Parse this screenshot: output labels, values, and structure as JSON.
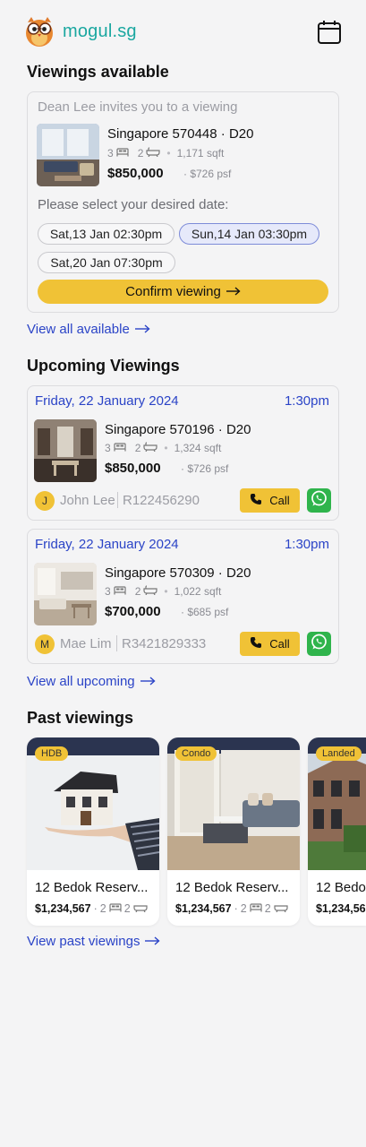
{
  "app": {
    "brand": "mogul.sg",
    "brand_color": "#1aa7a0",
    "accent_color": "#f0c236",
    "link_color": "#2b44c7"
  },
  "available": {
    "title": "Viewings available",
    "invite_text": "Dean Lee invites you to a viewing",
    "property": {
      "title": "Singapore 570448 · D20",
      "beds": "3",
      "baths": "2",
      "size": "1,171 sqft",
      "price": "$850,000",
      "psf": "· $726 psf"
    },
    "select_prompt": "Please select your desired date:",
    "dates": [
      {
        "label": "Sat,13 Jan 02:30pm",
        "selected": false
      },
      {
        "label": "Sun,14 Jan 03:30pm",
        "selected": true
      },
      {
        "label": "Sat,20 Jan 07:30pm",
        "selected": false
      }
    ],
    "confirm_label": "Confirm viewing",
    "view_all": "View all available"
  },
  "upcoming": {
    "title": "Upcoming Viewings",
    "items": [
      {
        "date": "Friday, 22 January 2024",
        "time": "1:30pm",
        "title": "Singapore 570196 · D20",
        "beds": "3",
        "baths": "2",
        "size": "1,324 sqft",
        "price": "$850,000",
        "psf": "· $726 psf",
        "agent_initial": "J",
        "agent_name": "John Lee",
        "agent_reg": "R122456290",
        "call_label": "Call"
      },
      {
        "date": "Friday, 22 January 2024",
        "time": "1:30pm",
        "title": "Singapore 570309 · D20",
        "beds": "3",
        "baths": "2",
        "size": "1,022 sqft",
        "price": "$700,000",
        "psf": "· $685 psf",
        "agent_initial": "M",
        "agent_name": "Mae Lim",
        "agent_reg": "R3421829333",
        "call_label": "Call"
      }
    ],
    "view_all": "View all upcoming"
  },
  "past": {
    "title": "Past viewings",
    "items": [
      {
        "tag": "HDB",
        "name": "12 Bedok Reserv...",
        "price": "$1,234,567",
        "beds": "2",
        "baths": "2"
      },
      {
        "tag": "Condo",
        "name": "12 Bedok Reserv...",
        "price": "$1,234,567",
        "beds": "2",
        "baths": "2"
      },
      {
        "tag": "Landed",
        "name": "12 Bedo",
        "price": "$1,234,56",
        "beds": "",
        "baths": ""
      }
    ],
    "view_all": "View past viewings"
  }
}
